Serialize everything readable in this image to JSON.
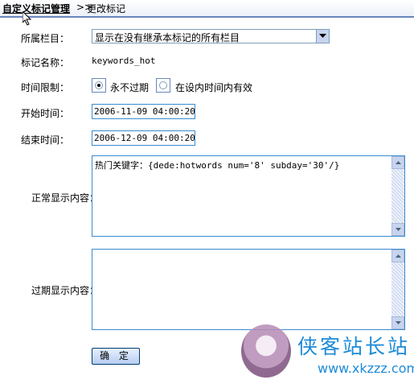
{
  "breadcrumb": {
    "main": "自定义标记管理",
    "separator": ">>",
    "current": "更改标记"
  },
  "form": {
    "column": {
      "label": "所属栏目：",
      "selected": "显示在没有继承本标记的所有栏目"
    },
    "tag_name": {
      "label": "标记名称：",
      "value": "keywords_hot"
    },
    "time_limit": {
      "label": "时间限制：",
      "option_never": "永不过期",
      "option_within": "在设内时间内有效",
      "selected": "option_never"
    },
    "start_time": {
      "label": "开始时间：",
      "value": "2006-11-09 04:00:20"
    },
    "end_time": {
      "label": "结束时间：",
      "value": "2006-12-09 04:00:20"
    },
    "normal_content": {
      "label": "正常显示内容：",
      "value": "热门关键字：{dede:hotwords num='8' subday='30'/}"
    },
    "expired_content": {
      "label": "过期显示内容：",
      "value": ""
    },
    "submit_label": "确 定"
  },
  "watermark": {
    "title": "侠客站长站",
    "url": "www.xkzzz.com"
  },
  "colors": {
    "header_border": "#6a86bd",
    "input_border": "#3a8bcf",
    "scrollbar": "#c8d4ee",
    "watermark_text": "#1d8bd8"
  }
}
